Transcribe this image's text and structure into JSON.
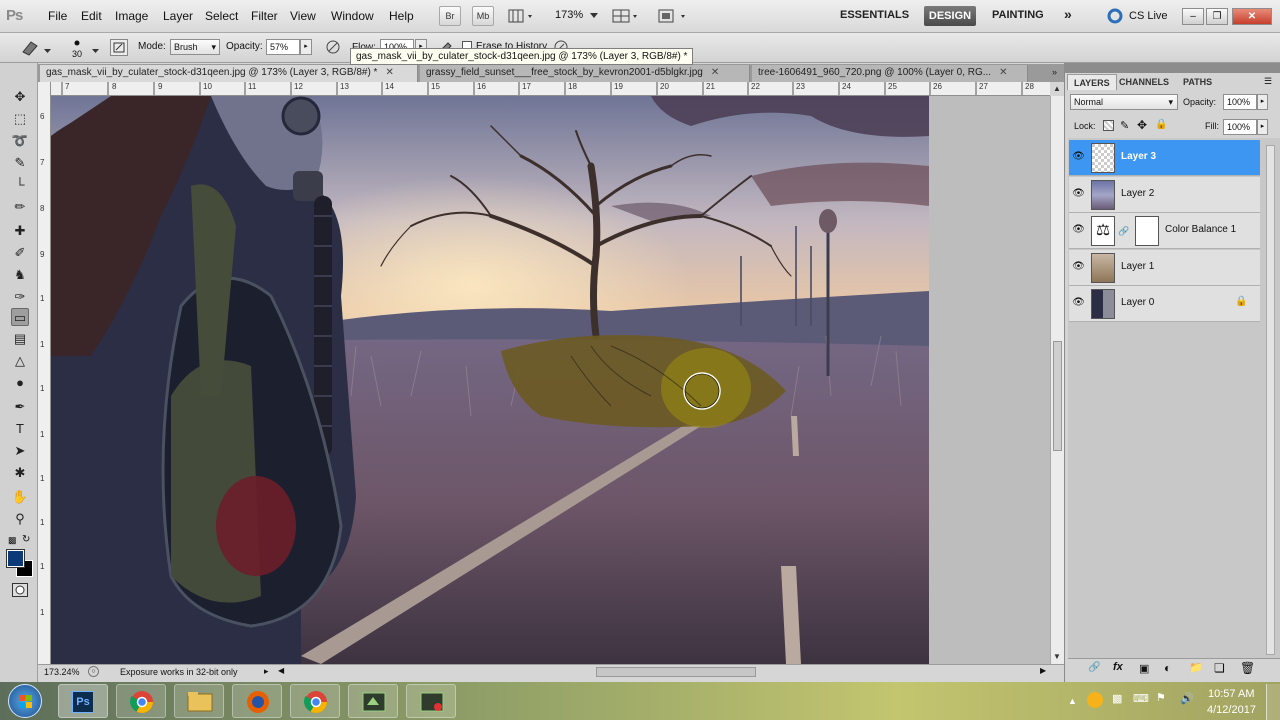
{
  "app": {
    "logo": "Ps"
  },
  "menu": [
    "File",
    "Edit",
    "Image",
    "Layer",
    "Select",
    "Filter",
    "View",
    "Window",
    "Help"
  ],
  "appbar": {
    "bridge": "Br",
    "minibridge": "Mb",
    "zoom": "173%"
  },
  "workspaces": {
    "essentials": "ESSENTIALS",
    "design": "DESIGN",
    "painting": "PAINTING",
    "more": "»"
  },
  "cslive": "CS Live",
  "options": {
    "brush_size": "30",
    "mode_label": "Mode:",
    "mode_value": "Brush",
    "opacity_label": "Opacity:",
    "opacity_value": "57%",
    "flow_label": "Flow:",
    "flow_value": "100%",
    "erase_history": "Erase to History"
  },
  "tooltip": "gas_mask_vii_by_culater_stock-d31qeen.jpg @ 173% (Layer 3, RGB/8#) *",
  "tabs": [
    {
      "label": "gas_mask_vii_by_culater_stock-d31qeen.jpg @ 173% (Layer 3, RGB/8#) *"
    },
    {
      "label": "grassy_field_sunset___free_stock_by_kevron2001-d5blgkr.jpg"
    },
    {
      "label": "tree-1606491_960_720.png @ 100% (Layer 0, RG..."
    }
  ],
  "ruler_h": [
    "7",
    "8",
    "9",
    "10",
    "11",
    "12",
    "13",
    "14",
    "15",
    "16",
    "17",
    "18",
    "19",
    "20",
    "21",
    "22",
    "23",
    "24",
    "25",
    "26",
    "27",
    "28"
  ],
  "ruler_v": [
    "6",
    "7",
    "8",
    "9",
    "1",
    "1",
    "1",
    "1",
    "1",
    "1",
    "1",
    "1",
    "1",
    "1"
  ],
  "status": {
    "zoom": "173.24%",
    "message": "Exposure works in 32-bit only"
  },
  "layers_panel": {
    "tabs": [
      "LAYERS",
      "CHANNELS",
      "PATHS"
    ],
    "blend_mode": "Normal",
    "opacity_label": "Opacity:",
    "opacity_value": "100%",
    "lock_label": "Lock:",
    "fill_label": "Fill:",
    "fill_value": "100%",
    "layers": [
      {
        "name": "Layer 3",
        "selected": true
      },
      {
        "name": "Layer 2",
        "selected": false
      },
      {
        "name": "Color Balance 1",
        "selected": false
      },
      {
        "name": "Layer 1",
        "selected": false
      },
      {
        "name": "Layer 0",
        "selected": false
      }
    ]
  },
  "taskbar": {
    "time": "10:57 AM",
    "date": "4/12/2017"
  },
  "colors": {
    "foreground": "#0c3a78",
    "background": "#000000",
    "selection": "#3d97f2"
  }
}
